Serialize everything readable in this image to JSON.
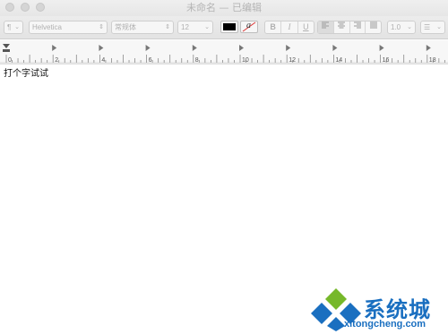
{
  "window": {
    "title": "未命名 — 已编辑"
  },
  "toolbar": {
    "paragraph_symbol": "¶",
    "font_family": "Helvetica",
    "font_style": "常规体",
    "font_size": "12",
    "text_color": "#000000",
    "highlight_label": "a",
    "bold_label": "B",
    "italic_label": "I",
    "underline_label": "U",
    "line_spacing": "1.0",
    "list_label": "☰"
  },
  "ruler": {
    "labels": [
      "0",
      "2",
      "4",
      "6",
      "8",
      "10",
      "12",
      "14",
      "16",
      "18"
    ]
  },
  "document": {
    "text": "打个字试试"
  },
  "watermark": {
    "brand": "系统城",
    "url": "xitongcheng.com",
    "colors": [
      "#76b82a",
      "#1a6fc0"
    ]
  }
}
